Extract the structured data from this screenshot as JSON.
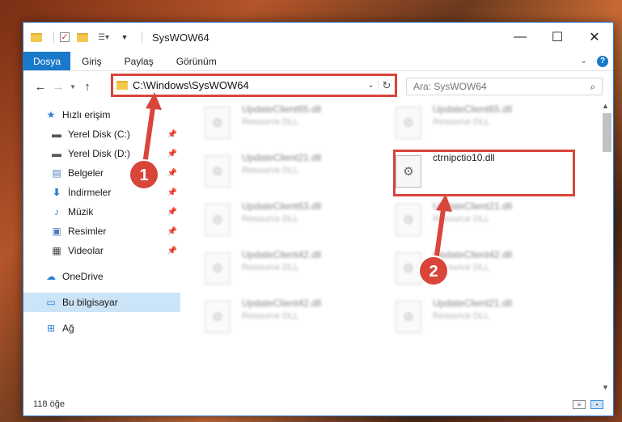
{
  "window": {
    "title": "SysWOW64",
    "controls": [
      "—",
      "☐",
      "✕"
    ]
  },
  "ribbon": {
    "tabs": [
      "Dosya",
      "Giriş",
      "Paylaş",
      "Görünüm"
    ],
    "help": "?"
  },
  "navigation": {
    "address": "C:\\Windows\\SysWOW64",
    "search_placeholder": "Ara: SysWOW64"
  },
  "sidebar": {
    "items": [
      {
        "label": "Hızlı erişim",
        "icon": "star-icon"
      },
      {
        "label": "Yerel Disk (C:)",
        "icon": "drive-icon"
      },
      {
        "label": "Yerel Disk (D:)",
        "icon": "drive-icon"
      },
      {
        "label": "Belgeler",
        "icon": "documents-icon"
      },
      {
        "label": "İndirmeler",
        "icon": "download-icon"
      },
      {
        "label": "Müzik",
        "icon": "music-icon"
      },
      {
        "label": "Resimler",
        "icon": "pictures-icon"
      },
      {
        "label": "Videolar",
        "icon": "video-icon"
      },
      {
        "label": "OneDrive",
        "icon": "cloud-icon"
      },
      {
        "label": "Bu bilgisayar",
        "icon": "computer-icon"
      },
      {
        "label": "Ağ",
        "icon": "network-icon"
      }
    ]
  },
  "files": [
    {
      "name": "UpdateClient65.dll",
      "type": "Resource DLL"
    },
    {
      "name": "UpdateClient65.dll",
      "type": "Resource DLL"
    },
    {
      "name": "UpdateClient21.dll",
      "type": "Resource DLL"
    },
    {
      "name": "ctrnipctio10.dll",
      "type": ""
    },
    {
      "name": "UpdateClient63.dll",
      "type": "Resource DLL"
    },
    {
      "name": "UpdateClient21.dll",
      "type": "Resource DLL"
    },
    {
      "name": "UpdateClient42.dll",
      "type": "Resource DLL"
    },
    {
      "name": "UpdateClient42.dll",
      "type": "Resource DLL"
    },
    {
      "name": "UpdateClient42.dll",
      "type": "Resource DLL"
    },
    {
      "name": "UpdateClient21.dll",
      "type": "Resource DLL"
    }
  ],
  "status": {
    "count": "118 öğe"
  },
  "annotations": {
    "step1": "1",
    "step2": "2",
    "color": "#d9453a"
  }
}
